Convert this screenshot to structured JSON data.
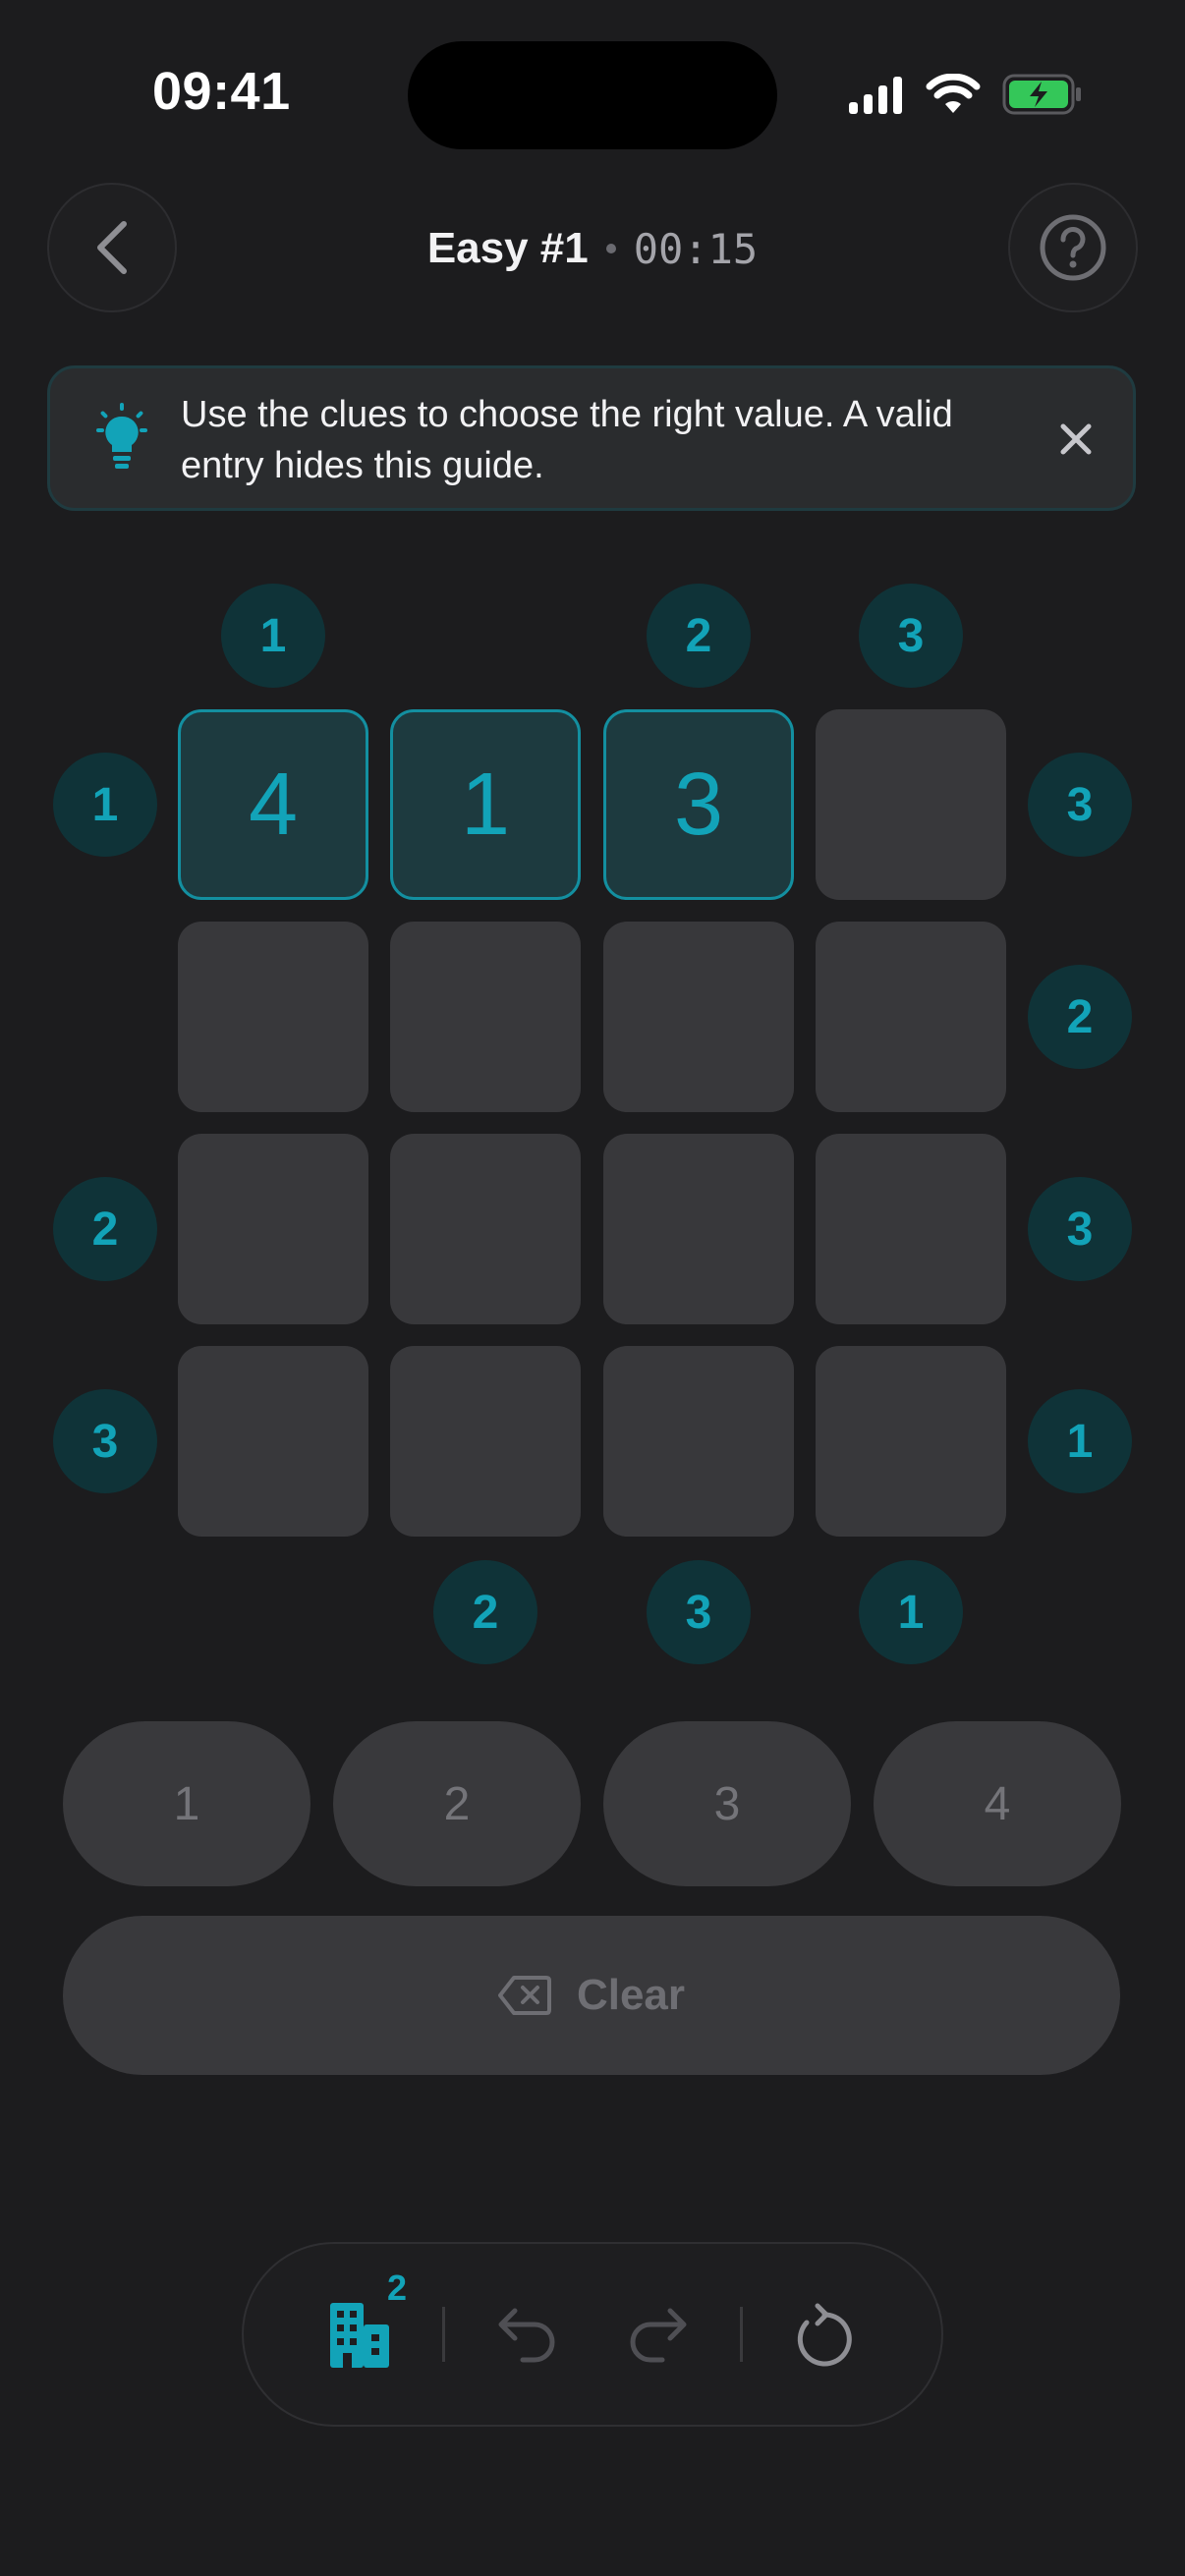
{
  "status_bar": {
    "time": "09:41"
  },
  "header": {
    "title": "Easy #1",
    "timer": "00:15"
  },
  "hint": {
    "text": "Use the clues to choose the right value. A valid entry hides this guide."
  },
  "puzzle": {
    "clues_top": [
      "1",
      "",
      "2",
      "3"
    ],
    "clues_bottom": [
      "",
      "2",
      "3",
      "1"
    ],
    "clues_left": [
      "1",
      "",
      "2",
      "3"
    ],
    "clues_right": [
      "3",
      "2",
      "3",
      "1"
    ],
    "grid": [
      [
        "4",
        "1",
        "3",
        ""
      ],
      [
        "",
        "",
        "",
        ""
      ],
      [
        "",
        "",
        "",
        ""
      ],
      [
        "",
        "",
        "",
        ""
      ]
    ]
  },
  "numpad": {
    "buttons": [
      "1",
      "2",
      "3",
      "4"
    ],
    "clear_label": "Clear"
  },
  "toolbar": {
    "building_badge": "2"
  },
  "colors": {
    "accent": "#12a3b8",
    "background": "#1c1c1e",
    "cell": "#38383b",
    "clue_bg": "#0f3338"
  },
  "icons": [
    "back-icon",
    "help-icon",
    "lightbulb-icon",
    "close-icon",
    "delete-icon",
    "building-icon",
    "undo-icon",
    "redo-icon",
    "restart-icon"
  ]
}
